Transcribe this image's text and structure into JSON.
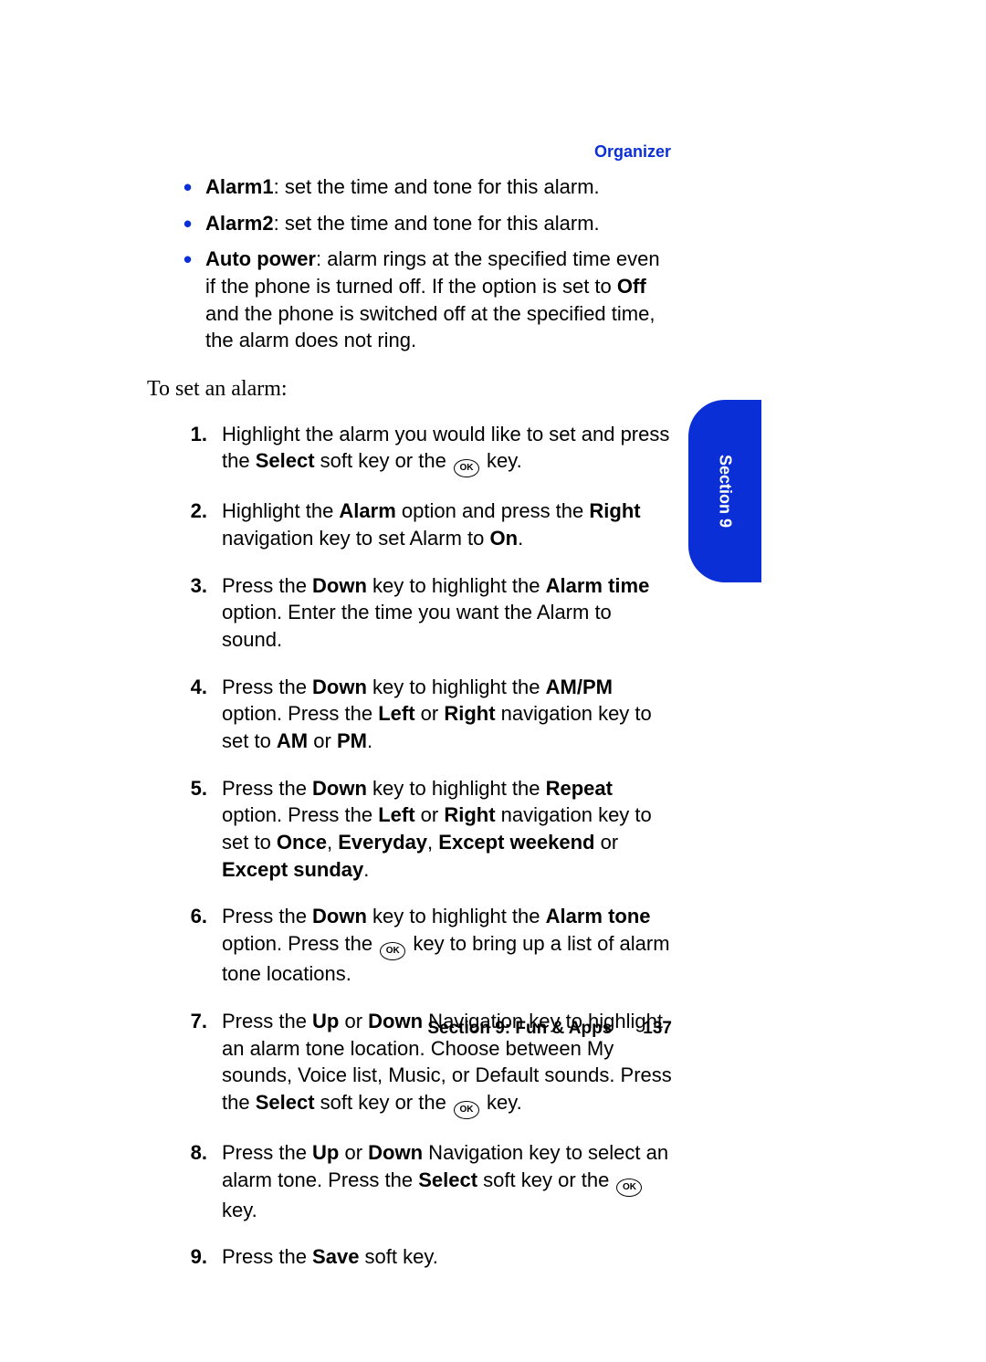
{
  "header": {
    "category": "Organizer"
  },
  "bullets": [
    {
      "term": "Alarm1",
      "desc": ": set the time and tone for this alarm."
    },
    {
      "term": "Alarm2",
      "desc": ": set the time and tone for this alarm."
    },
    {
      "term": "Auto power",
      "desc_before": ": alarm rings at the specified time even if the phone is turned off. If the option is set to ",
      "bold1": "Off",
      "desc_after": " and the phone is switched off at the specified time, the alarm does not ring."
    }
  ],
  "intro": "To set an alarm:",
  "steps": {
    "s1": {
      "t1": "Highlight the alarm you would like to set and press the ",
      "b1": "Select",
      "t2": " soft key or the ",
      "ok": "OK",
      "t3": " key."
    },
    "s2": {
      "t1": "Highlight the ",
      "b1": "Alarm",
      "t2": " option and press the ",
      "b2": "Right",
      "t3": " navigation key to set Alarm to ",
      "b3": "On",
      "t4": "."
    },
    "s3": {
      "t1": "Press the ",
      "b1": "Down",
      "t2": " key to highlight the ",
      "b2": "Alarm time",
      "t3": " option. Enter the time you want the Alarm to sound."
    },
    "s4": {
      "t1": "Press the ",
      "b1": "Down",
      "t2": " key to highlight the ",
      "b2": "AM/PM",
      "t3": " option. Press the ",
      "b3": "Left",
      "t4": " or ",
      "b4": "Right",
      "t5": " navigation key to set to ",
      "b5": "AM",
      "t6": " or ",
      "b6": "PM",
      "t7": "."
    },
    "s5": {
      "t1": "Press the ",
      "b1": "Down",
      "t2": " key to highlight the ",
      "b2": "Repeat",
      "t3": " option. Press the ",
      "b3": "Left",
      "t4": " or ",
      "b4": "Right",
      "t5": " navigation key to set to ",
      "b5": "Once",
      "t6": ", ",
      "b6": "Everyday",
      "t7": ", ",
      "b7": "Except weekend",
      "t8": " or ",
      "b8": "Except sunday",
      "t9": "."
    },
    "s6": {
      "t1": "Press the ",
      "b1": "Down",
      "t2": " key to highlight the ",
      "b2": "Alarm tone",
      "t3": " option. Press the ",
      "ok": "OK",
      "t4": " key to bring up a list of alarm tone locations."
    },
    "s7": {
      "t1": "Press the ",
      "b1": "Up",
      "t2": " or ",
      "b2": "Down",
      "t3": " Navigation key to highlight an alarm tone location. Choose between My sounds, Voice list, Music, or Default sounds. Press the ",
      "b3": "Select",
      "t4": " soft key or the ",
      "ok": "OK",
      "t5": " key."
    },
    "s8": {
      "t1": "Press the ",
      "b1": "Up",
      "t2": " or ",
      "b2": "Down",
      "t3": " Navigation key to select an alarm tone. Press the ",
      "b3": "Select",
      "t4": " soft key or the ",
      "ok": "OK",
      "t5": " key."
    },
    "s9": {
      "t1": "Press the ",
      "b1": "Save",
      "t2": " soft key."
    }
  },
  "sideTab": "Section 9",
  "footer": {
    "section": "Section 9: Fun & Apps",
    "page": "137"
  }
}
